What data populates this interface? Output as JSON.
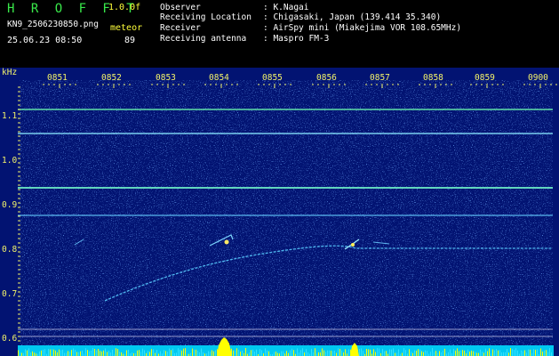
{
  "header": {
    "logo": "H R O F F T",
    "version": "1.0.0f",
    "filename": "KN9_2506230850.png",
    "meteor_label": "meteor",
    "datetime": "25.06.23 08:50",
    "meteor_count": "89"
  },
  "info": [
    {
      "key": "Observer",
      "value": ": K.Nagai"
    },
    {
      "key": "Receiving Location",
      "value": ": Chigasaki, Japan (139.414 35.340)"
    },
    {
      "key": "Receiver",
      "value": ": AirSpy mini (Miakejima VOR 108.65MHz)"
    },
    {
      "key": "Receiving antenna",
      "value": ": Maspro FM-3"
    }
  ],
  "axis": {
    "unit": "kHz",
    "y_ticks": [
      "1.1",
      "1.0",
      "0.9",
      "0.8",
      "0.7",
      "0.6"
    ],
    "x_ticks": [
      "0851",
      "0852",
      "0853",
      "0854",
      "0855",
      "0856",
      "0857",
      "0858",
      "0859",
      "0900"
    ]
  },
  "colors": {
    "background": "#021372",
    "label": "#f2f26a",
    "carrier": "#6fe0d8",
    "signal_edge": "#00d2ff",
    "signal_peak": "#ffff00"
  }
}
